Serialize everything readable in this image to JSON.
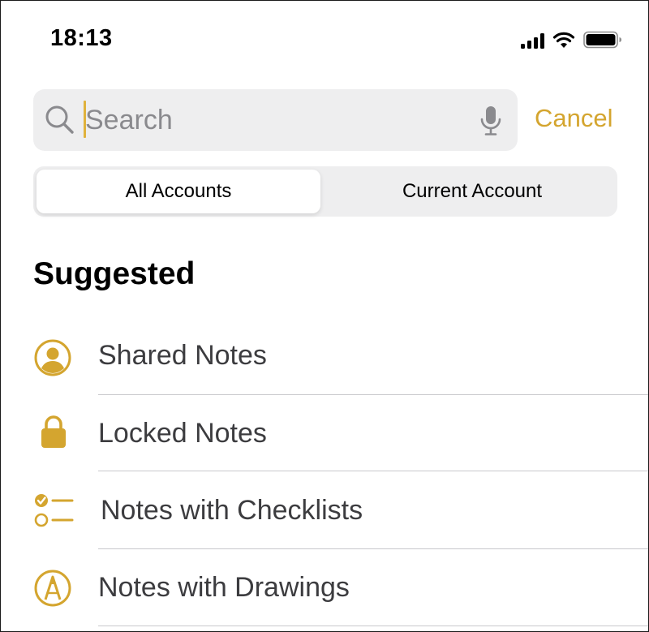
{
  "status_bar": {
    "time": "18:13",
    "icons": [
      "signal-icon",
      "wifi-icon",
      "battery-icon"
    ]
  },
  "search": {
    "placeholder": "Search",
    "value": "",
    "cancel_label": "Cancel",
    "icons": [
      "search-icon",
      "mic-icon"
    ]
  },
  "scope": {
    "options": [
      {
        "label": "All Accounts",
        "selected": true
      },
      {
        "label": "Current Account",
        "selected": false
      }
    ]
  },
  "suggested": {
    "title": "Suggested",
    "items": [
      {
        "label": "Shared Notes",
        "icon": "person-circle-icon"
      },
      {
        "label": "Locked Notes",
        "icon": "lock-icon"
      },
      {
        "label": "Notes with Checklists",
        "icon": "checklist-icon"
      },
      {
        "label": "Notes with Drawings",
        "icon": "pencil-tip-circle-icon"
      }
    ]
  },
  "colors": {
    "accent": "#d4a52f",
    "field_background": "#eeeeef",
    "placeholder": "#8a8a8e",
    "divider": "#c8c8cc"
  }
}
